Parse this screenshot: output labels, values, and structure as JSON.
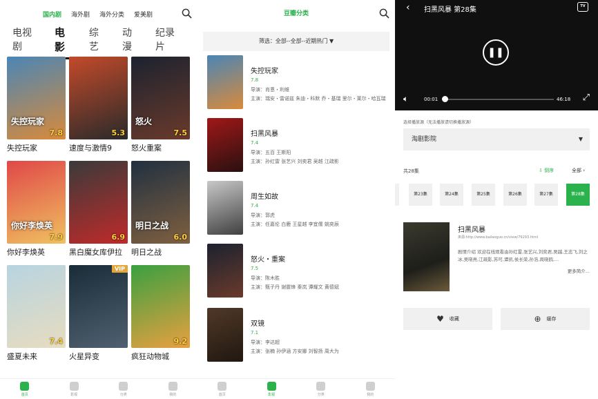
{
  "p1": {
    "nav": [
      "国内剧",
      "海外剧",
      "海外分类",
      "爱美剧"
    ],
    "tabs": [
      "电视剧",
      "电影",
      "综艺",
      "动漫",
      "纪录片"
    ],
    "movies": [
      {
        "title": "失控玩家",
        "rating": "7.8",
        "poster_text": "失控玩家",
        "vip": "",
        "c1": "#4a86b6",
        "c2": "#d98a3a"
      },
      {
        "title": "速度与激情9",
        "rating": "5.3",
        "poster_text": "",
        "vip": "",
        "c1": "#c34a2a",
        "c2": "#2a2a2a"
      },
      {
        "title": "怒火重案",
        "rating": "7.5",
        "poster_text": "怒火",
        "vip": "",
        "c1": "#1c2230",
        "c2": "#6a3a2a"
      },
      {
        "title": "你好李焕英",
        "rating": "7.9",
        "poster_text": "你好李焕英",
        "vip": "",
        "c1": "#e04848",
        "c2": "#f0c060"
      },
      {
        "title": "黑白魔女库伊拉",
        "rating": "6.9",
        "poster_text": "",
        "vip": "",
        "c1": "#3a3a3a",
        "c2": "#c02a2a"
      },
      {
        "title": "明日之战",
        "rating": "6.0",
        "poster_text": "明日之战",
        "vip": "",
        "c1": "#203040",
        "c2": "#806040"
      },
      {
        "title": "盛夏未来",
        "rating": "7.4",
        "poster_text": "",
        "vip": "",
        "c1": "#b7d4e0",
        "c2": "#e8dcc0"
      },
      {
        "title": "火星异变",
        "rating": "",
        "poster_text": "",
        "vip": "VIP",
        "c1": "#1a2c38",
        "c2": "#506070"
      },
      {
        "title": "疯狂动物城",
        "rating": "9.2",
        "poster_text": "",
        "vip": "",
        "c1": "#3aa040",
        "c2": "#e8a040"
      }
    ],
    "bottom": [
      "首页",
      "影视",
      "分类",
      "我的"
    ]
  },
  "p2": {
    "title": "豆瓣分类",
    "filter": "筛选：全部--全部--近期热门",
    "items": [
      {
        "title": "失控玩家",
        "rating": "7.8",
        "director": "导演：肖恩・利维",
        "actors": "主演：瑞安・雷诺兹 朱迪・科默 乔・基瑞 里尔・莱尔・哈瓦瑞",
        "c1": "#4a86b6",
        "c2": "#d98a3a"
      },
      {
        "title": "扫黑风暴",
        "rating": "7.4",
        "director": "导演：五百 王斯阳",
        "actors": "主演：孙红雷 张艺兴 刘奕君 吴越 江疏影",
        "c1": "#a01818",
        "c2": "#2a1010"
      },
      {
        "title": "周生如故",
        "rating": "7.4",
        "director": "导演：郭虎",
        "actors": "主演：任嘉伦 白鹿 王星越 李宜儒 姚奕辰",
        "c1": "#c8c8c8",
        "c2": "#404040"
      },
      {
        "title": "怒火・重案",
        "rating": "7.5",
        "director": "导演：陈木胜",
        "actors": "主演：甄子丹 谢霆锋 秦岚 谭耀文 黄德斌",
        "c1": "#1c2230",
        "c2": "#6a3a2a"
      },
      {
        "title": "双镜",
        "rating": "7.1",
        "director": "导演：李达超",
        "actors": "主演：张楠 孙伊涵 方安娜 刘智扬 周大为",
        "c1": "#503828",
        "c2": "#201810"
      }
    ],
    "bottom": [
      "首页",
      "影视",
      "分类",
      "我的"
    ]
  },
  "p3": {
    "play_title": "扫黑风暴 第28集",
    "tv": "TV",
    "time_cur": "00:01",
    "time_end": "46:18",
    "progress": 0.01,
    "src_label": "选择播放源（无法播放请切换播放源）",
    "src_value": "淘剧影院",
    "ep_count": "共28集",
    "sort": "倒序",
    "all": "全部",
    "episodes": [
      "第23集",
      "第24集",
      "第25集",
      "第26集",
      "第27集",
      "第28集"
    ],
    "detail_title": "扫黑风暴",
    "detail_url": "來源:http://www.bailaoguo.cn/view/79293.html",
    "detail_desc": "剧情介绍 欢迎在线观看由孙红雷,张艺兴,刘奕君,吴越,王志飞,刘之冰,吴晓亮,江疏影,苏可,谭凯,侯长荣,孙浩,周晓鸥,...",
    "more": "更多简介...",
    "fav": "收藏",
    "cache": "缓存"
  }
}
